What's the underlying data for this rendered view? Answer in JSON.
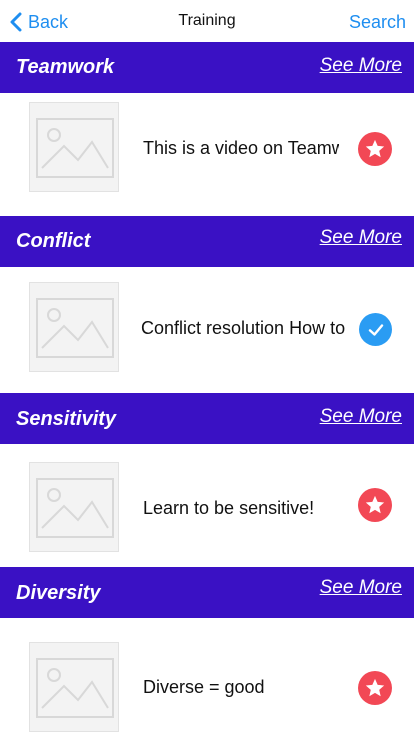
{
  "nav": {
    "back_label": "Back",
    "title": "Training",
    "search_label": "Search"
  },
  "colors": {
    "accent": "#1e8ef0",
    "section_bg": "#3a11c4",
    "star_badge": "#f24855",
    "check_badge": "#2a9cf3"
  },
  "sections": [
    {
      "title": "Teamwork",
      "see_more": "See More",
      "item_text": "This is a video on Teamwork",
      "badge_icon": "star-icon"
    },
    {
      "title": "Conflict",
      "see_more": "See More",
      "item_text": "Conflict resolution How to",
      "badge_icon": "check-icon"
    },
    {
      "title": "Sensitivity",
      "see_more": "See More",
      "item_text": "Learn to be sensitive!",
      "badge_icon": "star-icon"
    },
    {
      "title": "Diversity",
      "see_more": "See More",
      "item_text": "Diverse = good",
      "badge_icon": "star-icon"
    }
  ]
}
